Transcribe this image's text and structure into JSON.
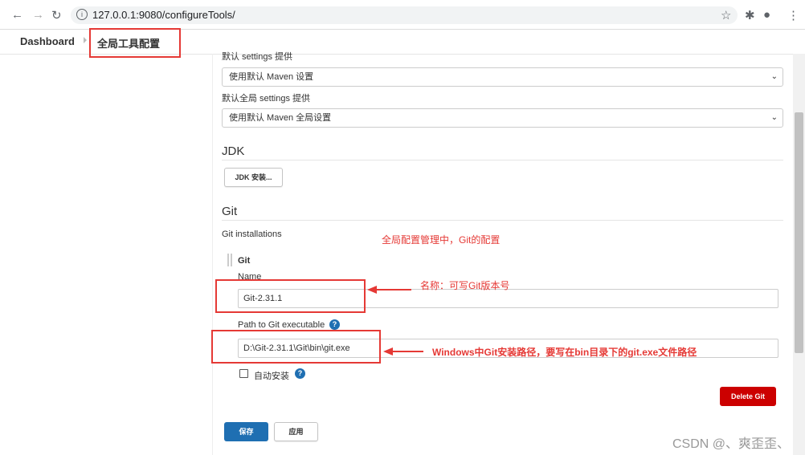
{
  "browser": {
    "url": "127.0.0.1:9080/configureTools/",
    "back_icon": "back-arrow-icon",
    "forward_icon": "forward-arrow-icon",
    "reload_icon": "reload-icon"
  },
  "breadcrumb": {
    "dashboard": "Dashboard",
    "current": "全局工具配置"
  },
  "maven": {
    "settings_label_partial": "默认 settings 提供",
    "settings_value": "使用默认 Maven 设置",
    "global_settings_label": "默认全局 settings 提供",
    "global_settings_value": "使用默认 Maven 全局设置"
  },
  "jdk": {
    "title": "JDK",
    "install_button": "JDK 安装..."
  },
  "git": {
    "title": "Git",
    "installations_label": "Git installations",
    "item_title": "Git",
    "name_label": "Name",
    "name_value": "Git-2.31.1",
    "path_label": "Path to Git executable",
    "path_value": "D:\\Git-2.31.1\\Git\\bin\\git.exe",
    "auto_install_label": "自动安装",
    "delete_button": "Delete Git"
  },
  "annotations": {
    "note1": "全局配置管理中，Git的配置",
    "note2": "名称：可写Git版本号",
    "note3": "Windows中Git安装路径，要写在bin目录下的git.exe文件路径"
  },
  "footer": {
    "save": "保存",
    "apply": "应用"
  },
  "watermark": "CSDN @、爽歪歪、",
  "colors": {
    "accent_blue": "#1f6fb2",
    "danger_red": "#cc0000",
    "annotation_red": "#e53935"
  }
}
